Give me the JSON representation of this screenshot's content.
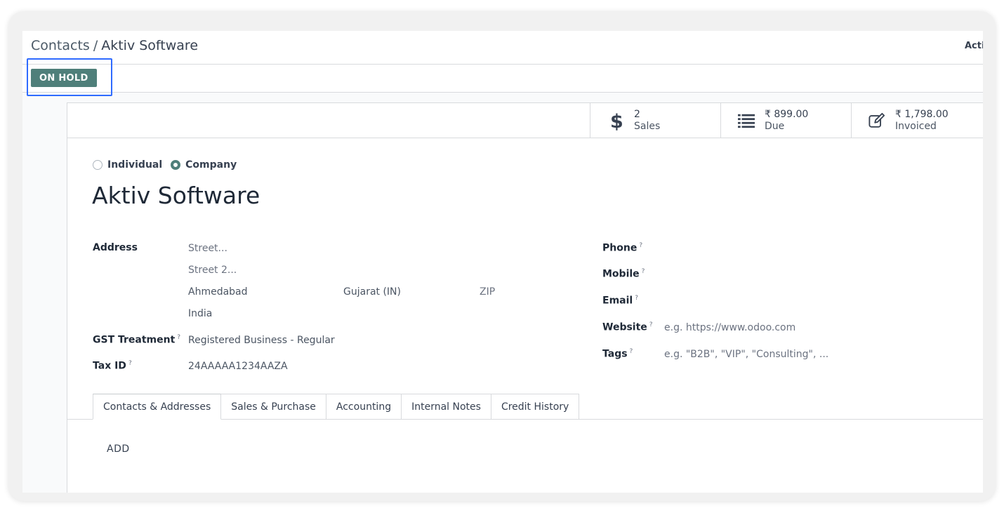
{
  "breadcrumb": {
    "parent": "Contacts",
    "separator": "/",
    "current": "Aktiv Software"
  },
  "action_menu": {
    "label": "Action"
  },
  "statusbar": {
    "on_hold_label": "ON HOLD"
  },
  "stat_buttons": [
    {
      "icon": "dollar-icon",
      "value": "2",
      "label": "Sales"
    },
    {
      "icon": "list-icon",
      "value": "₹ 899.00",
      "label": "Due"
    },
    {
      "icon": "edit-icon",
      "value": "₹ 1,798.00",
      "label": "Invoiced"
    }
  ],
  "company_type": {
    "individual": "Individual",
    "company": "Company",
    "selected": "company"
  },
  "name": "Aktiv Software",
  "address": {
    "label": "Address",
    "street_placeholder": "Street...",
    "street2_placeholder": "Street 2...",
    "city": "Ahmedabad",
    "state": "Gujarat (IN)",
    "zip_placeholder": "ZIP",
    "country": "India"
  },
  "gst_treatment": {
    "label": "GST Treatment",
    "help": "?",
    "value": "Registered Business - Regular"
  },
  "tax_id": {
    "label": "Tax ID",
    "help": "?",
    "value": "24AAAAA1234AAZA"
  },
  "phone": {
    "label": "Phone",
    "help": "?"
  },
  "mobile": {
    "label": "Mobile",
    "help": "?"
  },
  "email": {
    "label": "Email",
    "help": "?"
  },
  "website": {
    "label": "Website",
    "help": "?",
    "placeholder": "e.g. https://www.odoo.com"
  },
  "tags": {
    "label": "Tags",
    "help": "?",
    "placeholder": "e.g. \"B2B\", \"VIP\", \"Consulting\", ..."
  },
  "tabs": [
    {
      "label": "Contacts & Addresses",
      "active": true
    },
    {
      "label": "Sales & Purchase",
      "active": false
    },
    {
      "label": "Accounting",
      "active": false
    },
    {
      "label": "Internal Notes",
      "active": false
    },
    {
      "label": "Credit History",
      "active": false
    }
  ],
  "add_label": "ADD",
  "colors": {
    "primary": "#4f7f7a",
    "highlight": "#2f6bff",
    "border": "#d8dadd"
  }
}
